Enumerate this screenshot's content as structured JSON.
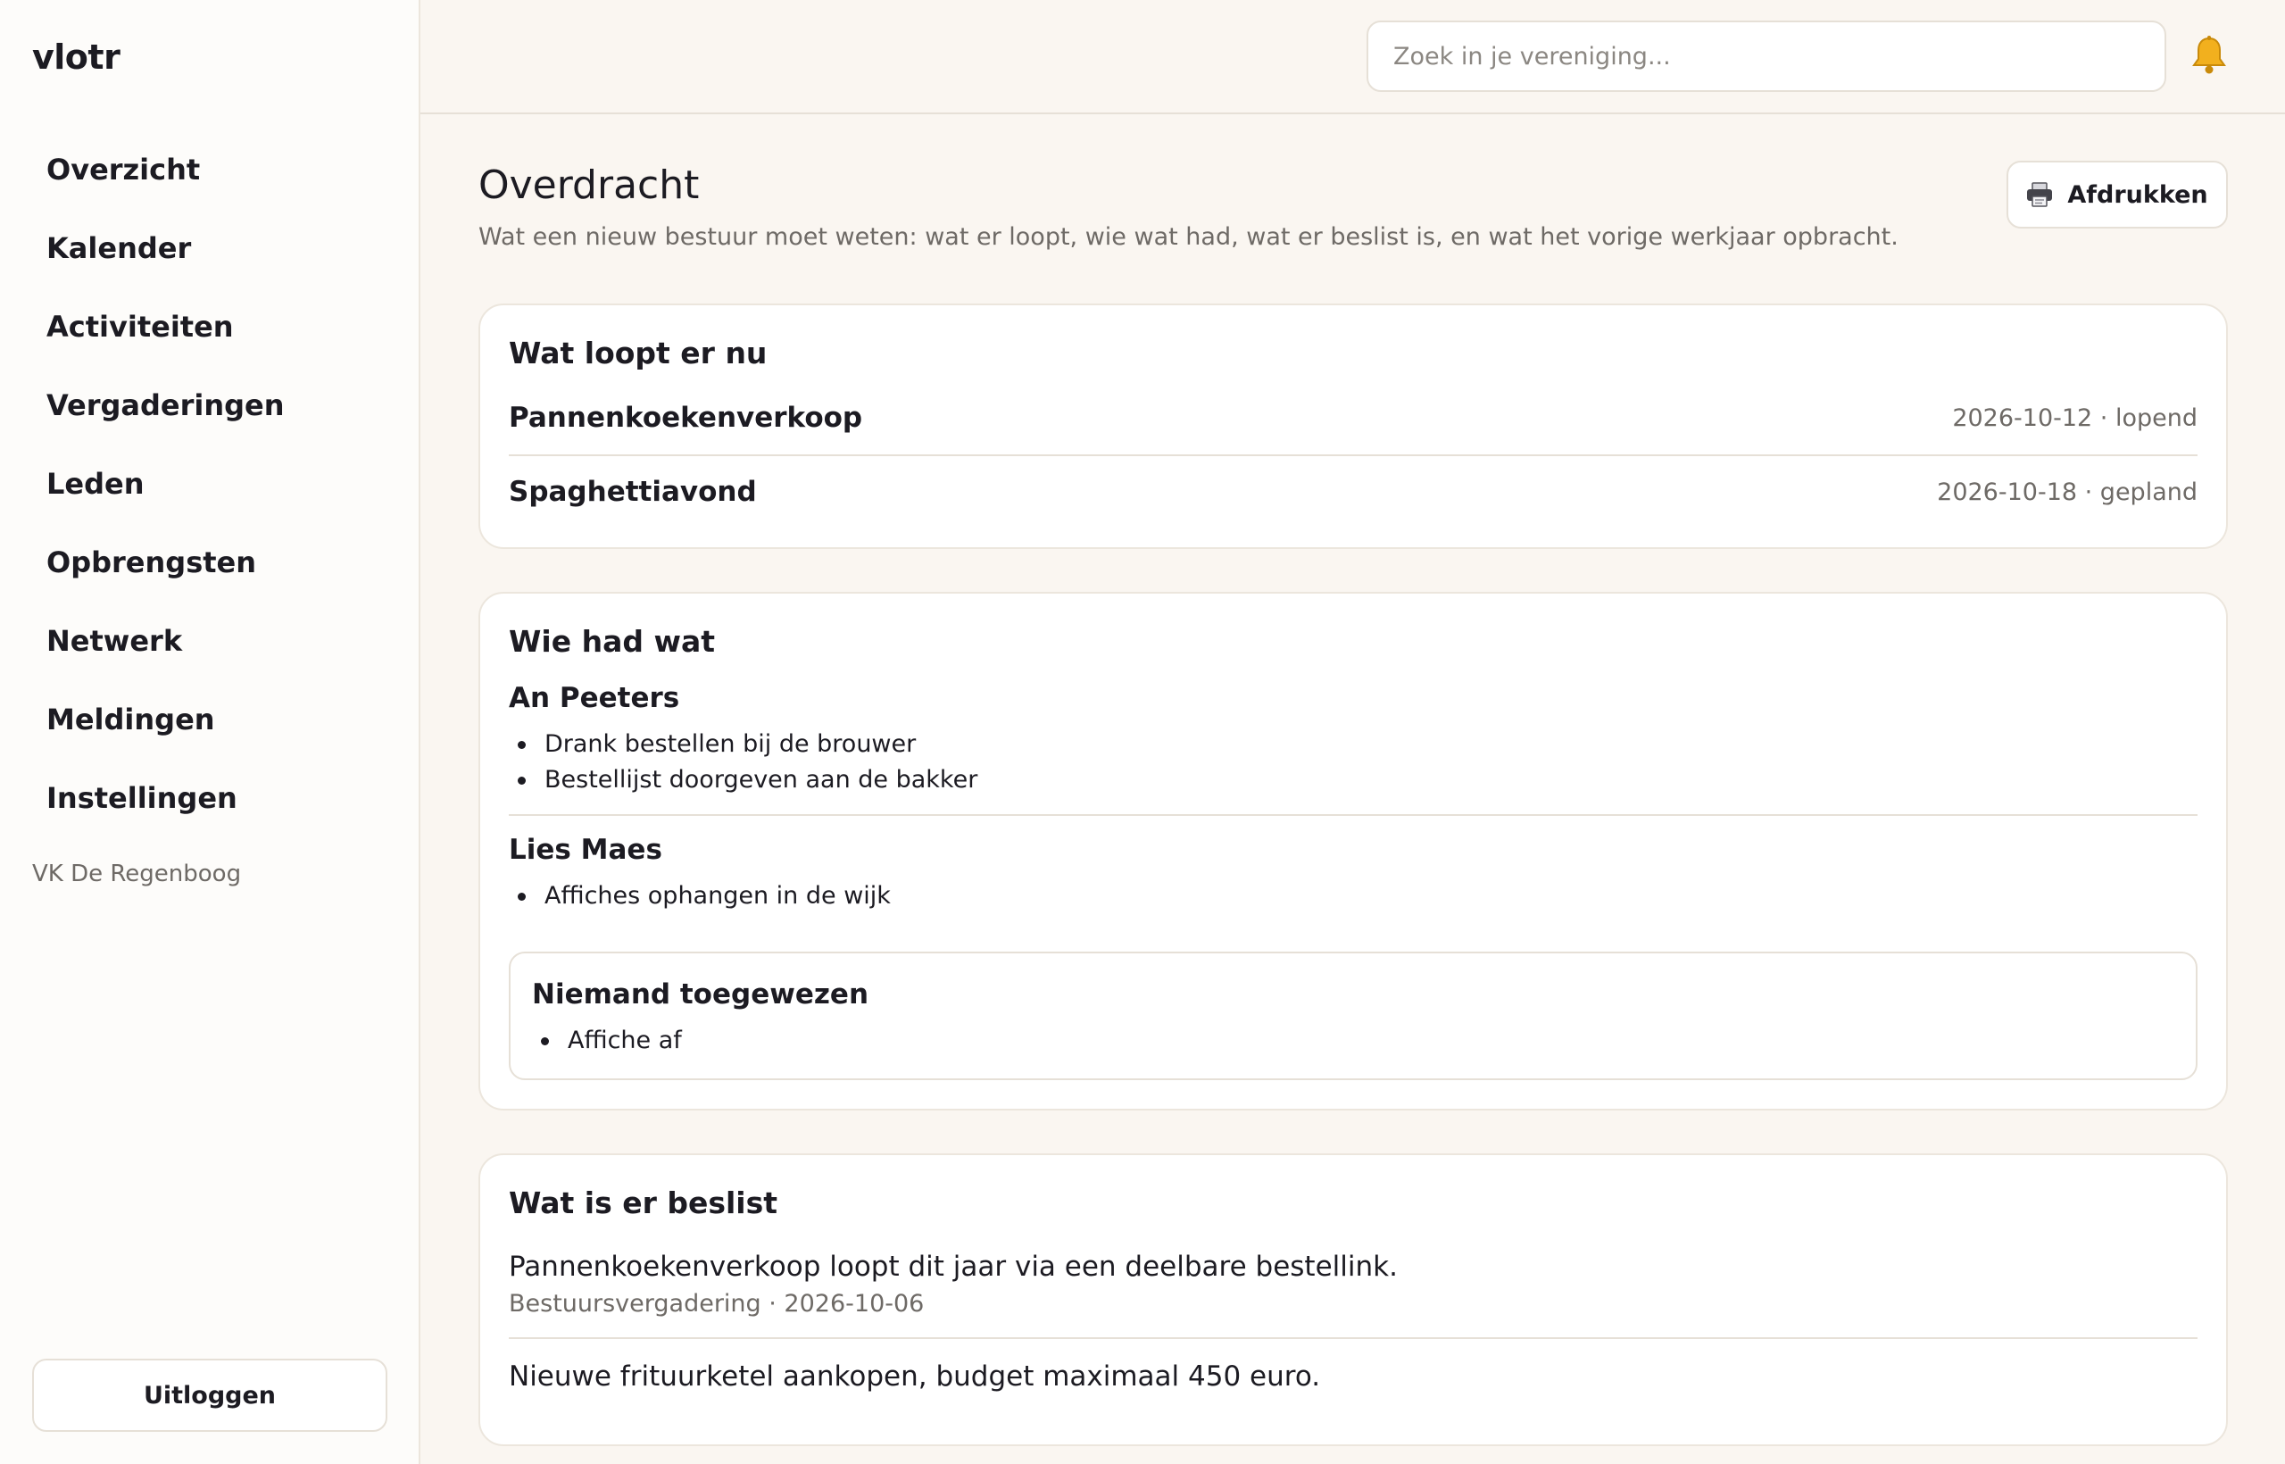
{
  "app": {
    "brand": "vlotr",
    "organization": "VK De Regenboog"
  },
  "sidebar": {
    "items": [
      {
        "label": "Overzicht"
      },
      {
        "label": "Kalender"
      },
      {
        "label": "Activiteiten"
      },
      {
        "label": "Vergaderingen"
      },
      {
        "label": "Leden"
      },
      {
        "label": "Opbrengsten"
      },
      {
        "label": "Netwerk"
      },
      {
        "label": "Meldingen"
      },
      {
        "label": "Instellingen"
      }
    ],
    "logout_label": "Uitloggen"
  },
  "topbar": {
    "search_placeholder": "Zoek in je vereniging...",
    "bell_icon": "bell-icon"
  },
  "page": {
    "title": "Overdracht",
    "subtitle": "Wat een nieuw bestuur moet weten: wat er loopt, wie wat had, wat er beslist is, en wat het vorige werkjaar opbracht.",
    "print_label": "Afdrukken",
    "print_icon": "printer-icon"
  },
  "running": {
    "title": "Wat loopt er nu",
    "items": [
      {
        "name": "Pannenkoekenverkoop",
        "meta": "2026-10-12 · lopend"
      },
      {
        "name": "Spaghettiavond",
        "meta": "2026-10-18 · gepland"
      }
    ]
  },
  "responsibilities": {
    "title": "Wie had wat",
    "people": [
      {
        "name": "An Peeters",
        "tasks": [
          "Drank bestellen bij de brouwer",
          "Bestellijst doorgeven aan de bakker"
        ]
      },
      {
        "name": "Lies Maes",
        "tasks": [
          "Affiches ophangen in de wijk"
        ]
      }
    ],
    "unassigned": {
      "title": "Niemand toegewezen",
      "tasks": [
        "Affiche af"
      ]
    }
  },
  "decisions": {
    "title": "Wat is er beslist",
    "items": [
      {
        "text": "Pannenkoekenverkoop loopt dit jaar via een deelbare bestellink.",
        "meta": "Bestuursvergadering · 2026-10-06"
      },
      {
        "text": "Nieuwe frituurketel aankopen, budget maximaal 450 euro.",
        "meta": ""
      }
    ]
  }
}
